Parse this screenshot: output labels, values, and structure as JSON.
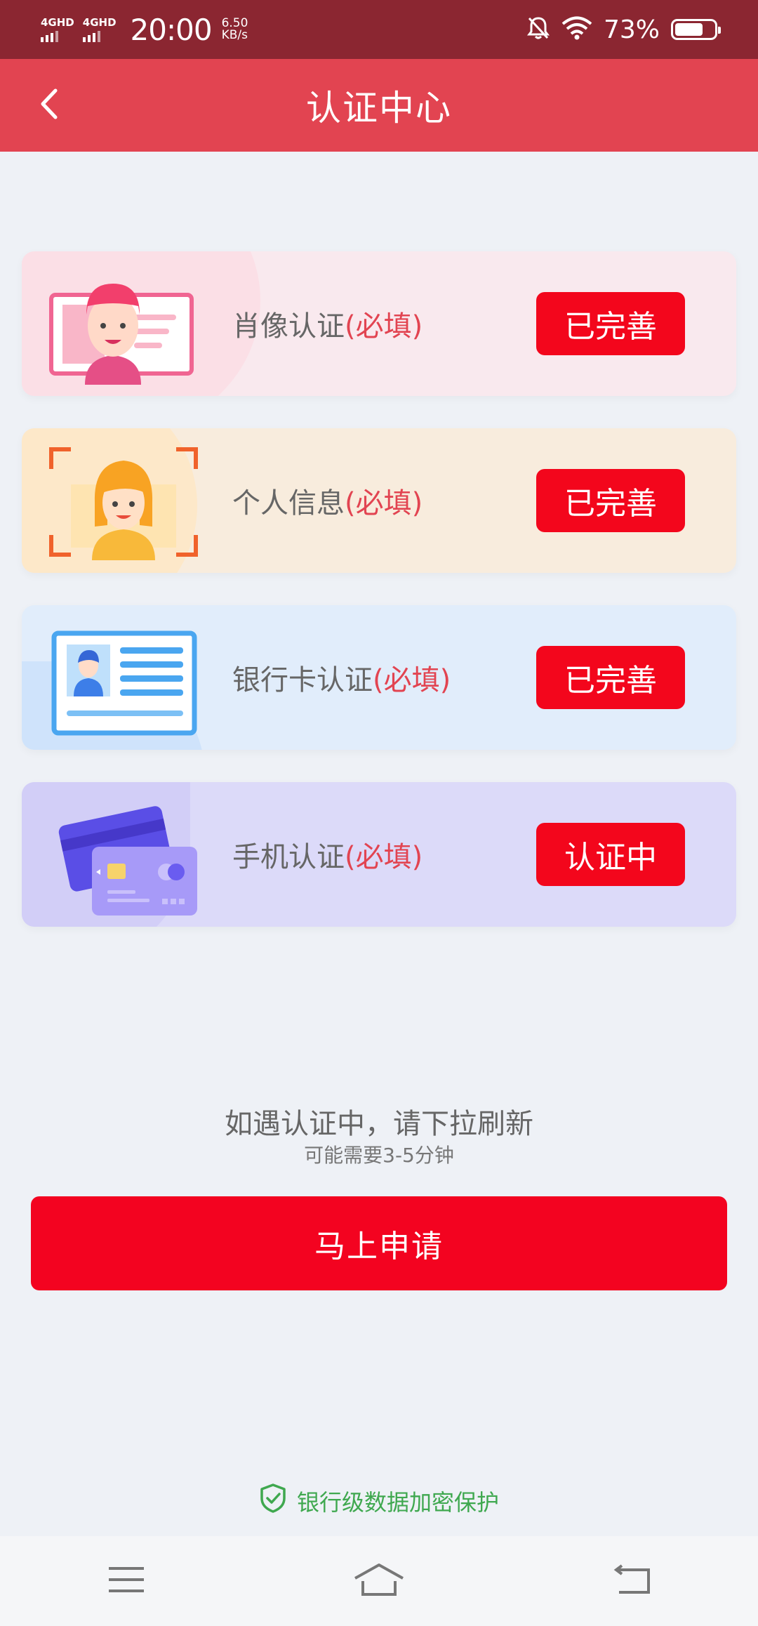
{
  "status_bar": {
    "sim1": "4GHD",
    "sim2": "4GHD",
    "time": "20:00",
    "speed_value": "6.50",
    "speed_unit": "KB/s",
    "battery_percent": "73%",
    "battery_level": 0.73
  },
  "header": {
    "title": "认证中心",
    "back_icon": "chevron-left-icon"
  },
  "cards": [
    {
      "label": "肖像认证",
      "required": "(必填)",
      "button": "已完善",
      "bg": "#f9e9ee",
      "icon": "portrait-icon"
    },
    {
      "label": "个人信息",
      "required": "(必填)",
      "button": "已完善",
      "bg": "#f8ecdd",
      "icon": "personal-info-icon"
    },
    {
      "label": "银行卡认证",
      "required": "(必填)",
      "button": "已完善",
      "bg": "#e1edfb",
      "icon": "id-card-icon"
    },
    {
      "label": "手机认证",
      "required": "(必填)",
      "button": "认证中",
      "bg": "#dcdaf9",
      "icon": "bank-card-icon"
    }
  ],
  "hint": {
    "main": "如遇认证中，请下拉刷新",
    "sub": "可能需要3-5分钟"
  },
  "apply_button": "马上申请",
  "security_note": "银行级数据加密保护",
  "colors": {
    "status_bar": "#8b2631",
    "header": "#e24451",
    "button_red": "#f3061c",
    "secure_green": "#3fa84f",
    "page_bg": "#eef1f6"
  },
  "nav": {
    "menu_icon": "menu-icon",
    "home_icon": "home-icon",
    "back_icon": "back-icon"
  }
}
